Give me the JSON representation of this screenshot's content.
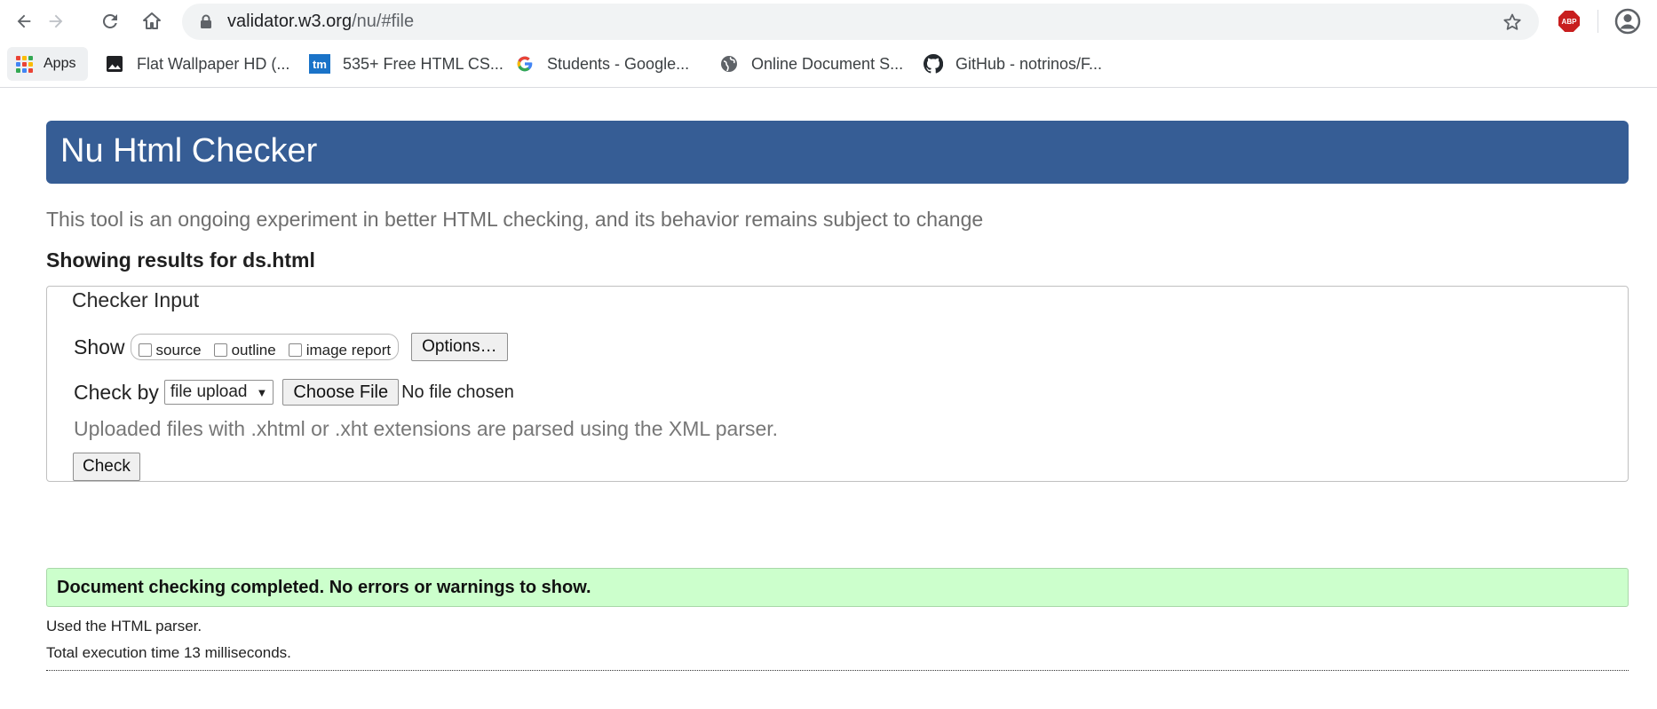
{
  "browser": {
    "url_host": "validator.w3.org",
    "url_path": "/nu/#file",
    "abp_label": "ABP",
    "bookmarks": [
      {
        "label": "Apps",
        "icon": "apps-grid-icon"
      },
      {
        "label": "Flat Wallpaper HD (...",
        "icon": "image-icon"
      },
      {
        "label": "535+ Free HTML CS...",
        "icon": "tm-icon",
        "icon_text": "tm"
      },
      {
        "label": "Students - Google...",
        "icon": "google-icon"
      },
      {
        "label": "Online Document S...",
        "icon": "globe-icon"
      },
      {
        "label": "GitHub - notrinos/F...",
        "icon": "github-icon"
      }
    ]
  },
  "page": {
    "title": "Nu Html Checker",
    "tagline": "This tool is an ongoing experiment in better HTML checking, and its behavior remains subject to change",
    "results_for": "Showing results for ds.html",
    "checker": {
      "legend": "Checker Input",
      "show_label": "Show",
      "show_options": [
        "source",
        "outline",
        "image report"
      ],
      "options_button": "Options…",
      "check_by_label": "Check by",
      "check_by_value": "file upload",
      "choose_file_button": "Choose File",
      "no_file_text": "No file chosen",
      "note": "Uploaded files with .xhtml or .xht extensions are parsed using the XML parser.",
      "check_button": "Check"
    },
    "success_message": "Document checking completed. No errors or warnings to show.",
    "parser_info": "Used the HTML parser.",
    "execution_time": "Total execution time 13 milliseconds."
  },
  "colors": {
    "header_bg": "#365d95",
    "success_bg": "#ccffcc",
    "abp_red": "#c81e1e"
  }
}
